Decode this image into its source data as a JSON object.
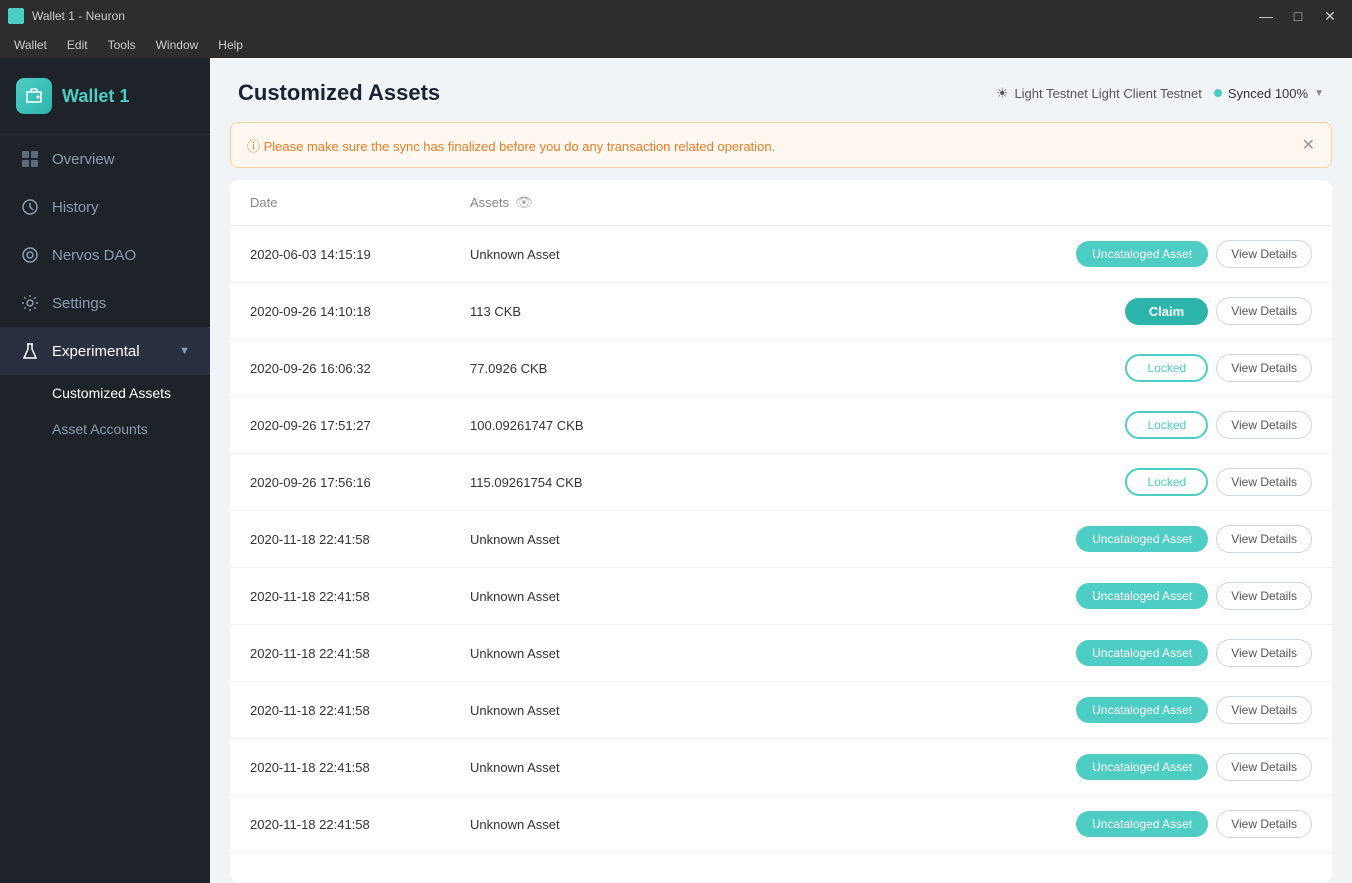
{
  "titlebar": {
    "icon": "⬡",
    "title": "Wallet 1 - Neuron",
    "controls": [
      "—",
      "□",
      "✕"
    ]
  },
  "menubar": {
    "items": [
      "Wallet",
      "Edit",
      "Tools",
      "Window",
      "Help"
    ]
  },
  "sidebar": {
    "wallet_name": "Wallet 1",
    "nav_items": [
      {
        "id": "overview",
        "label": "Overview",
        "icon": "⊞"
      },
      {
        "id": "history",
        "label": "History",
        "icon": "⊙"
      },
      {
        "id": "nervos-dao",
        "label": "Nervos DAO",
        "icon": "◎"
      },
      {
        "id": "settings",
        "label": "Settings",
        "icon": "⚙"
      }
    ],
    "experimental_label": "Experimental",
    "sub_items": [
      {
        "id": "customized-assets",
        "label": "Customized Assets",
        "active": true
      },
      {
        "id": "asset-accounts",
        "label": "Asset Accounts",
        "active": false
      }
    ]
  },
  "topbar": {
    "page_title": "Customized Assets",
    "network_label": "Light Testnet Light Client Testnet",
    "sync_label": "Synced 100%"
  },
  "warning": {
    "message": "ⓘ  Please make sure the sync has finalized before you do any transaction related operation.",
    "close_label": "✕"
  },
  "table": {
    "col_date": "Date",
    "col_assets": "Assets",
    "rows": [
      {
        "date": "2020-06-03 14:15:19",
        "assets": "Unknown Asset",
        "status": "uncataloged",
        "status_label": "Uncataloged Asset",
        "view_label": "View Details"
      },
      {
        "date": "2020-09-26 14:10:18",
        "assets": "113 CKB",
        "status": "claim",
        "status_label": "Claim",
        "view_label": "View Details"
      },
      {
        "date": "2020-09-26 16:06:32",
        "assets": "77.0926 CKB",
        "status": "locked",
        "status_label": "Locked",
        "view_label": "View Details"
      },
      {
        "date": "2020-09-26 17:51:27",
        "assets": "100.09261747 CKB",
        "status": "locked",
        "status_label": "Locked",
        "view_label": "View Details"
      },
      {
        "date": "2020-09-26 17:56:16",
        "assets": "115.09261754 CKB",
        "status": "locked",
        "status_label": "Locked",
        "view_label": "View Details"
      },
      {
        "date": "2020-11-18 22:41:58",
        "assets": "Unknown Asset",
        "status": "uncataloged",
        "status_label": "Uncataloged Asset",
        "view_label": "View Details"
      },
      {
        "date": "2020-11-18 22:41:58",
        "assets": "Unknown Asset",
        "status": "uncataloged",
        "status_label": "Uncataloged Asset",
        "view_label": "View Details"
      },
      {
        "date": "2020-11-18 22:41:58",
        "assets": "Unknown Asset",
        "status": "uncataloged",
        "status_label": "Uncataloged Asset",
        "view_label": "View Details"
      },
      {
        "date": "2020-11-18 22:41:58",
        "assets": "Unknown Asset",
        "status": "uncataloged",
        "status_label": "Uncataloged Asset",
        "view_label": "View Details"
      },
      {
        "date": "2020-11-18 22:41:58",
        "assets": "Unknown Asset",
        "status": "uncataloged",
        "status_label": "Uncataloged Asset",
        "view_label": "View Details"
      },
      {
        "date": "2020-11-18 22:41:58",
        "assets": "Unknown Asset",
        "status": "uncataloged",
        "status_label": "Uncataloged Asset",
        "view_label": "View Details"
      }
    ]
  }
}
